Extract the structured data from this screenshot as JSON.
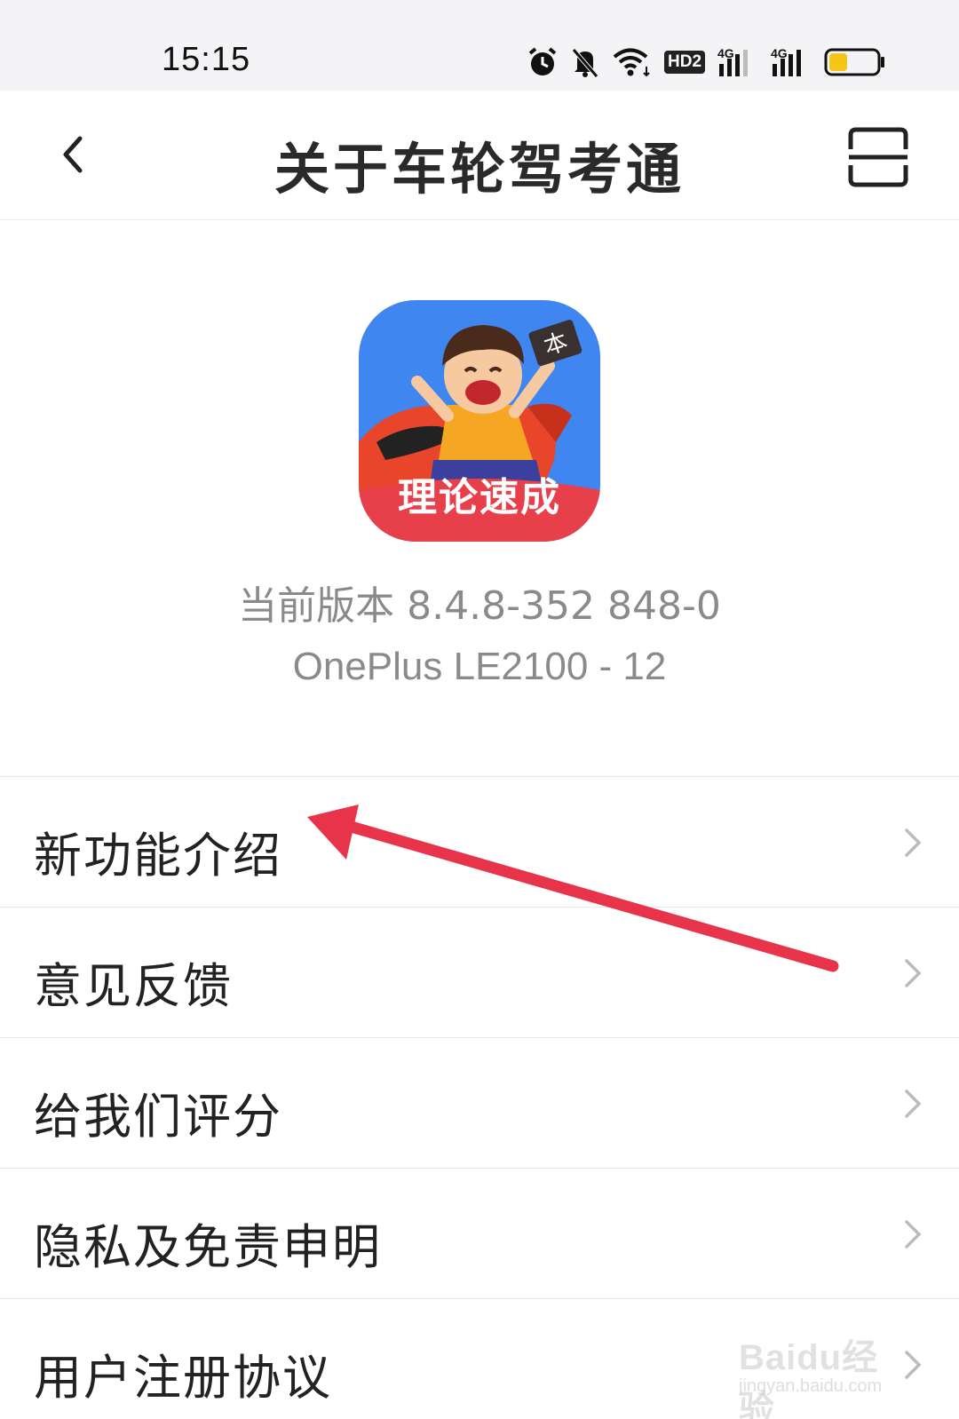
{
  "status_bar": {
    "time": "15:15",
    "icons": [
      "alarm-icon",
      "mute-bell-icon",
      "wifi-icon",
      "hd-icon",
      "signal-4g-icon",
      "signal-4g-icon",
      "battery-icon"
    ],
    "hd_label": "HD2",
    "network_label": "4G",
    "battery_color": "#f5c518"
  },
  "header": {
    "title": "关于车轮驾考通",
    "back_icon": "chevron-left-icon",
    "scan_icon": "scan-icon"
  },
  "app_info": {
    "logo_label": "理论速成",
    "logo_badge": "本",
    "version": "当前版本 8.4.8-352 848-0",
    "device": "OnePlus LE2100 - 12"
  },
  "menu": {
    "items": [
      {
        "label": "新功能介绍"
      },
      {
        "label": "意见反馈"
      },
      {
        "label": "给我们评分"
      },
      {
        "label": "隐私及免责申明"
      },
      {
        "label": "用户注册协议"
      }
    ]
  },
  "annotation": {
    "color": "#e8344a"
  },
  "watermark": {
    "brand": "Baidu经验",
    "url": "jingyan.baidu.com"
  },
  "colors": {
    "logo_bg": "#3f86f0",
    "logo_ribbon": "#e8404a"
  }
}
